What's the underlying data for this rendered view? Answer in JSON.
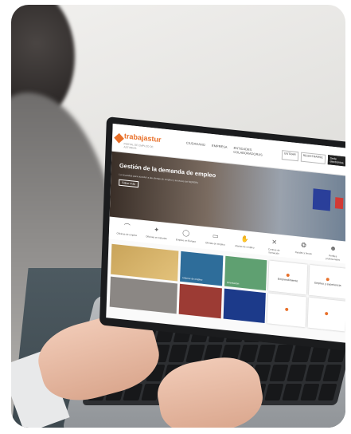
{
  "site": {
    "logo_text": "trabajastur",
    "logo_sub": "PORTAL DE EMPLEO DE ASTURIAS"
  },
  "nav": [
    "CIUDADANO",
    "EMPRESA",
    "ENTIDADES COLABORADORAS"
  ],
  "top_buttons": [
    "ENTRAR",
    "REGISTRARSE",
    "Sede electrónica"
  ],
  "hero": {
    "title": "Gestión de la demanda de empleo",
    "subtitle": "Lo necesitas para acceder a las ofertas de empleo y servicios del SEPEPA",
    "button": "Saber más"
  },
  "icon_links": [
    {
      "icon": "map-icon",
      "glyph": "⌒",
      "label": "Oficinas de empleo"
    },
    {
      "icon": "region-icon",
      "glyph": "✦",
      "label": "Oficinas en Asturias"
    },
    {
      "icon": "globe-icon",
      "glyph": "◯",
      "label": "Empleo en Europa"
    },
    {
      "icon": "briefcase-icon",
      "glyph": "▭",
      "label": "Ofertas de empleo"
    },
    {
      "icon": "hand-icon",
      "glyph": "✋",
      "label": "Alertas de empleo"
    },
    {
      "icon": "tools-icon",
      "glyph": "✕",
      "label": "Centros de formación"
    },
    {
      "icon": "lifebuoy-icon",
      "glyph": "❂",
      "label": "Ayudas y becas"
    },
    {
      "icon": "people-icon",
      "glyph": "☻",
      "label": "Perfiles profesionales"
    }
  ],
  "tiles": [
    {
      "style": "gold",
      "text": ""
    },
    {
      "style": "blue",
      "text": "Informe de empleo"
    },
    {
      "style": "green",
      "text": "Orientación"
    },
    {
      "style": "white",
      "text": "Emprendimiento"
    },
    {
      "style": "white",
      "text": "Empleo y experiencia"
    },
    {
      "style": "grey",
      "text": ""
    },
    {
      "style": "red",
      "text": ""
    },
    {
      "style": "eu",
      "text": ""
    },
    {
      "style": "white",
      "text": ""
    },
    {
      "style": "white",
      "text": ""
    }
  ],
  "colors": {
    "brand_orange": "#e8702a",
    "laptop_grey": "#b9bcbf",
    "background": "#ffffff"
  }
}
